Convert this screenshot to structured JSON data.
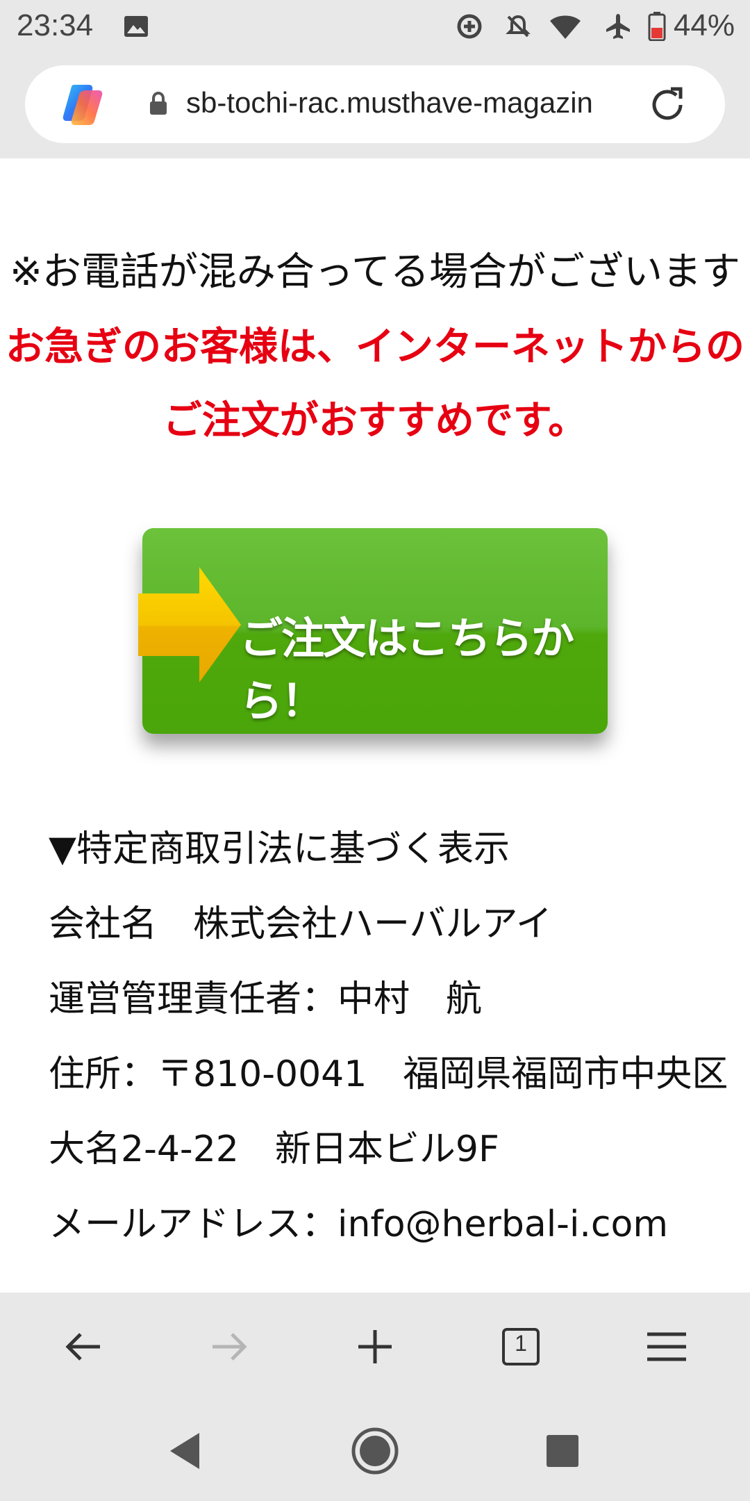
{
  "status_bar": {
    "time": "23:34",
    "battery": "44%",
    "icons": [
      "image-icon",
      "data-saver-icon",
      "mute-icon",
      "wifi-icon",
      "airplane-icon",
      "battery-icon"
    ]
  },
  "browser": {
    "url": "sb-tochi-rac.musthave-magazin",
    "icons": [
      "copilot-icon",
      "lock-icon",
      "reload-icon"
    ]
  },
  "page": {
    "notice_line1": "※お電話が混み合ってる場合がございます",
    "notice_red_line1": "お急ぎのお客様は、インターネットからの",
    "notice_red_line2": "ご注文がおすすめです。",
    "order_button_label": "ご注文はこちらから！",
    "info": [
      "▼特定商取引法に基づく表示",
      "会社名　株式会社ハーバルアイ",
      "運営管理責任者：中村　航",
      "住所：〒810-0041　福岡県福岡市中央区",
      "大名2-4-22　新日本ビル9F",
      "メールアドレス：info@herbal-i.com"
    ],
    "colors": {
      "red": "#e60012",
      "button_green": "#4fa80c",
      "arrow_yellow": "#f2c200"
    }
  },
  "toolbar": {
    "tab_count": "1",
    "icons": [
      "back-arrow-icon",
      "forward-arrow-icon",
      "plus-icon",
      "tabs-icon",
      "menu-icon"
    ]
  },
  "navbar": {
    "icons": [
      "nav-back-icon",
      "nav-home-icon",
      "nav-recents-icon"
    ]
  }
}
